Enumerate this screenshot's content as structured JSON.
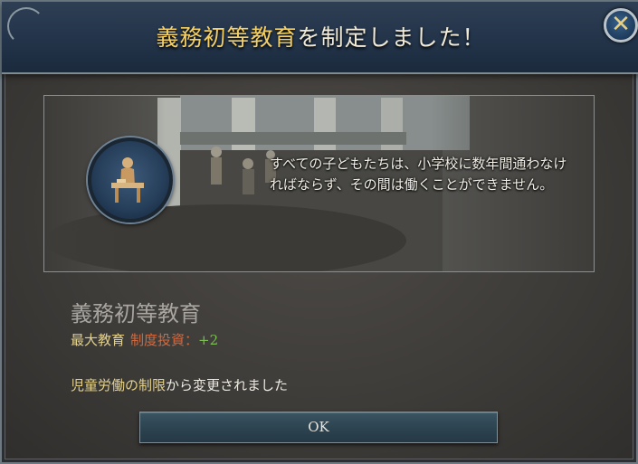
{
  "title": {
    "highlight": "義務初等教育",
    "rest": "を制定しました！"
  },
  "close_button": {
    "icon": "close-icon",
    "glyph": "✕"
  },
  "banner": {
    "description": "すべての子どもたちは、小学校に数年間通わなければならず、その間は働くことができません。",
    "medal_icon": "teacher-at-desk-icon"
  },
  "law": {
    "name": "義務初等教育",
    "effect_key": "最大教育",
    "effect_label": "制度投資：",
    "effect_value": "+2",
    "changed_from": "児童労働の制限",
    "changed_suffix": "から変更されました"
  },
  "ok_button": {
    "label": "OK"
  },
  "colors": {
    "title_highlight": "#f4cf63",
    "effect_key": "#e3d08a",
    "effect_label": "#d1693f",
    "effect_value": "#78c04f"
  }
}
